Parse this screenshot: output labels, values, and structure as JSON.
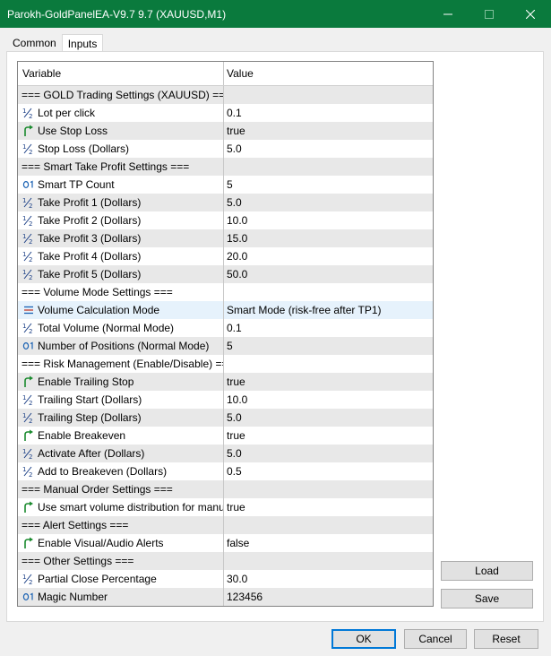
{
  "window": {
    "title": "Parokh-GoldPanelEA-V9.7 9.7 (XAUUSD,M1)"
  },
  "tabs": [
    "Common",
    "Inputs"
  ],
  "table": {
    "headers": {
      "variable": "Variable",
      "value": "Value"
    },
    "rows": [
      {
        "icon": "none",
        "name": "=== GOLD Trading Settings (XAUUSD) ===",
        "value": ""
      },
      {
        "icon": "fraction-icon",
        "name": "Lot per click",
        "value": "0.1"
      },
      {
        "icon": "bool-arrow-icon",
        "name": "Use Stop Loss",
        "value": "true"
      },
      {
        "icon": "fraction-icon",
        "name": "Stop Loss (Dollars)",
        "value": "5.0"
      },
      {
        "icon": "none",
        "name": "=== Smart Take Profit Settings ===",
        "value": ""
      },
      {
        "icon": "integer-icon",
        "name": "Smart TP Count",
        "value": "5"
      },
      {
        "icon": "fraction-icon",
        "name": "Take Profit 1 (Dollars)",
        "value": "5.0"
      },
      {
        "icon": "fraction-icon",
        "name": "Take Profit 2 (Dollars)",
        "value": "10.0"
      },
      {
        "icon": "fraction-icon",
        "name": "Take Profit 3 (Dollars)",
        "value": "15.0"
      },
      {
        "icon": "fraction-icon",
        "name": "Take Profit 4 (Dollars)",
        "value": "20.0"
      },
      {
        "icon": "fraction-icon",
        "name": "Take Profit 5 (Dollars)",
        "value": "50.0"
      },
      {
        "icon": "none",
        "name": "=== Volume Mode Settings ===",
        "value": ""
      },
      {
        "icon": "enum-list-icon",
        "name": "Volume Calculation Mode",
        "value": "Smart Mode (risk-free after TP1)"
      },
      {
        "icon": "fraction-icon",
        "name": "Total Volume (Normal Mode)",
        "value": "0.1"
      },
      {
        "icon": "integer-icon",
        "name": "Number of Positions (Normal Mode)",
        "value": "5"
      },
      {
        "icon": "none",
        "name": "=== Risk Management (Enable/Disable) ===",
        "value": ""
      },
      {
        "icon": "bool-arrow-icon",
        "name": "Enable Trailing Stop",
        "value": "true"
      },
      {
        "icon": "fraction-icon",
        "name": "Trailing Start (Dollars)",
        "value": "10.0"
      },
      {
        "icon": "fraction-icon",
        "name": "Trailing Step (Dollars)",
        "value": "5.0"
      },
      {
        "icon": "bool-arrow-icon",
        "name": "Enable Breakeven",
        "value": "true"
      },
      {
        "icon": "fraction-icon",
        "name": "Activate After (Dollars)",
        "value": "5.0"
      },
      {
        "icon": "fraction-icon",
        "name": "Add to Breakeven (Dollars)",
        "value": "0.5"
      },
      {
        "icon": "none",
        "name": "=== Manual Order Settings ===",
        "value": ""
      },
      {
        "icon": "bool-arrow-icon",
        "name": "Use smart volume distribution for manua...",
        "value": "true"
      },
      {
        "icon": "none",
        "name": "=== Alert Settings ===",
        "value": ""
      },
      {
        "icon": "bool-arrow-icon",
        "name": "Enable Visual/Audio Alerts",
        "value": "false"
      },
      {
        "icon": "none",
        "name": "=== Other Settings ===",
        "value": ""
      },
      {
        "icon": "fraction-icon",
        "name": "Partial Close Percentage",
        "value": "30.0"
      },
      {
        "icon": "integer-icon",
        "name": "Magic Number",
        "value": "123456"
      }
    ],
    "selected_row": 12
  },
  "side_buttons": {
    "load": "Load",
    "save": "Save"
  },
  "footer_buttons": {
    "ok": "OK",
    "cancel": "Cancel",
    "reset": "Reset"
  },
  "colors": {
    "titlebar": "#0a7a3d",
    "bool_icon": "#1a8a2e",
    "int_icon": "#1a62b3",
    "selection": "#e6f2fc",
    "alt_row": "#e8e8e8"
  }
}
